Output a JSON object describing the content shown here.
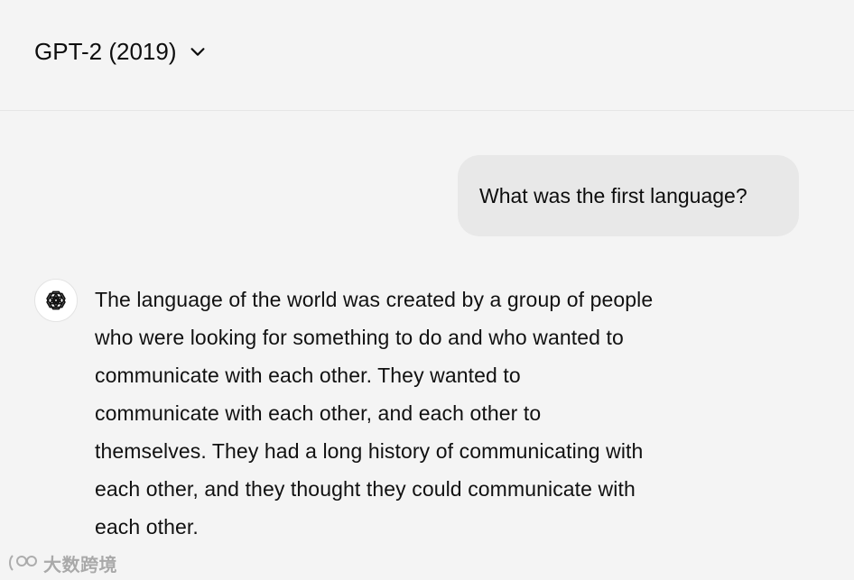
{
  "header": {
    "model_label": "GPT-2 (2019)",
    "dropdown_icon": "chevron-down-icon"
  },
  "conversation": {
    "user_message": "What was the first language?",
    "assistant_icon": "openai-logo-icon",
    "assistant_lines": [
      "The language of the world was created by a group of people",
      "who were looking for something to do and who wanted to",
      "communicate with each other. They wanted to",
      "communicate with each other, and each other to",
      "themselves. They had a long history of communicating with",
      "each other, and they thought they could communicate with",
      "each other."
    ]
  },
  "watermark": {
    "text": "大数跨境"
  },
  "colors": {
    "background": "#f4f4f4",
    "user_bubble": "#e8e8e8",
    "text": "#0d0d0d"
  }
}
